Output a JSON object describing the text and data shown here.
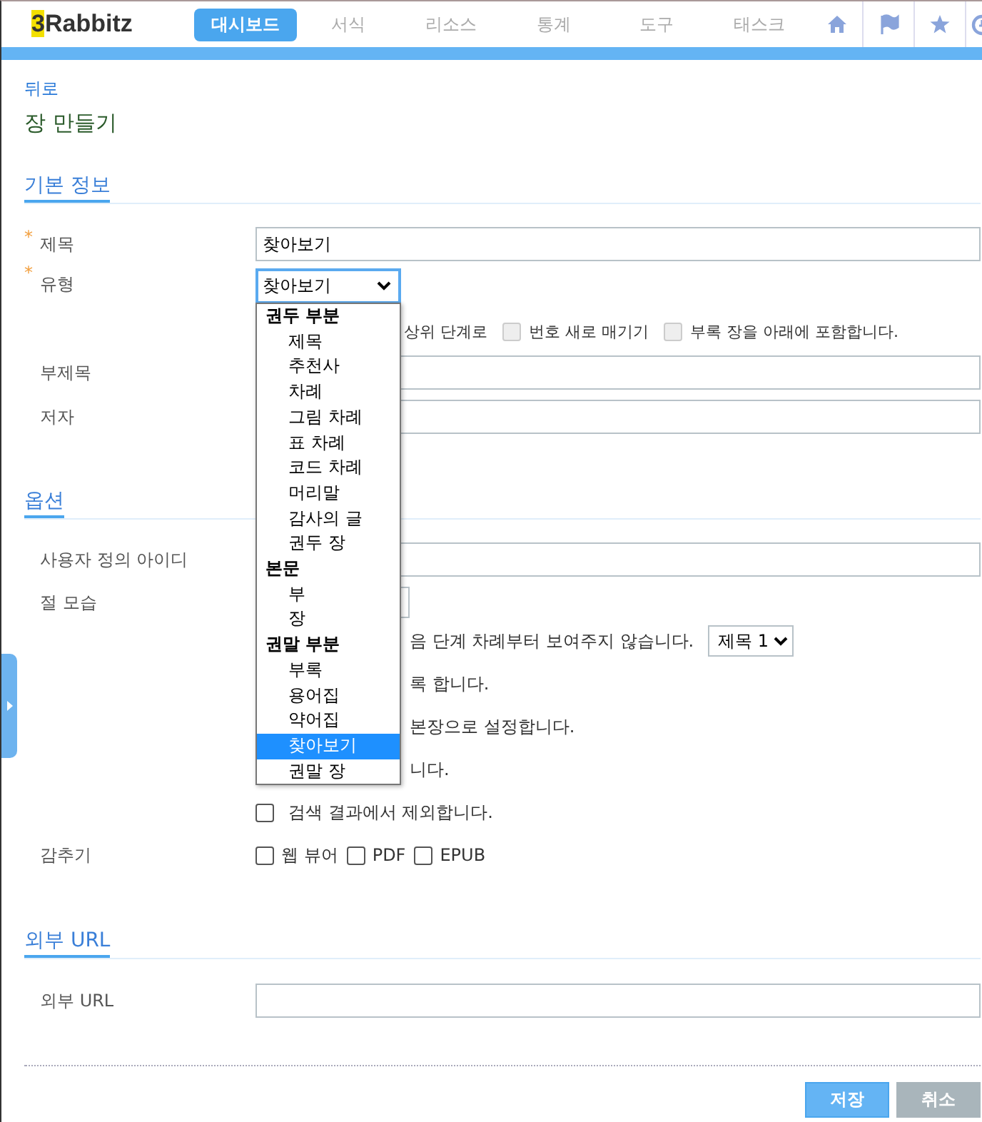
{
  "header": {
    "logo": {
      "digit": "3",
      "letters": "Rabbitz"
    },
    "tabs": [
      {
        "label": "대시보드",
        "selected": true
      },
      {
        "label": "서식",
        "selected": false
      },
      {
        "label": "리소스",
        "selected": false
      },
      {
        "label": "통계",
        "selected": false
      },
      {
        "label": "도구",
        "selected": false
      },
      {
        "label": "태스크",
        "selected": false
      }
    ]
  },
  "back_link": "뒤로",
  "page_title": "장 만들기",
  "basic_info": {
    "heading": "기본 정보",
    "title_field": {
      "label": "제목",
      "required_mark": "*",
      "value": "찾아보기"
    },
    "type_field": {
      "label": "유형",
      "required_mark": "*",
      "value": "찾아보기"
    },
    "type_checks": [
      {
        "kind": "partial",
        "text": "상위 단계로"
      },
      {
        "kind": "checkbox",
        "text": "번호 새로 매기기",
        "checked": false,
        "disabled": true
      },
      {
        "kind": "checkbox",
        "text": "부록 장을 아래에 포함합니다.",
        "checked": false,
        "disabled": true
      }
    ],
    "subtitle_field": {
      "label": "부제목"
    },
    "author_field": {
      "label": "저자"
    }
  },
  "options": {
    "heading": "옵션",
    "custom_id_field": {
      "label": "사용자 정의 아이디"
    },
    "section_style_label": "절 모습",
    "rows": [
      {
        "kind": "text_select",
        "text": "음 단계 차례부터 보여주지 않습니다.",
        "select_value": "제목 1"
      },
      {
        "kind": "partial",
        "text": "록 합니다."
      },
      {
        "kind": "partial",
        "text": "본장으로 설정합니다."
      },
      {
        "kind": "partial",
        "text": "니다."
      },
      {
        "kind": "checkbox",
        "text": "검색 결과에서 제외합니다.",
        "checked": false
      }
    ],
    "hide": {
      "label": "감추기",
      "options": [
        {
          "label": "웹 뷰어",
          "checked": false
        },
        {
          "label": "PDF",
          "checked": false
        },
        {
          "label": "EPUB",
          "checked": false
        }
      ]
    }
  },
  "external": {
    "heading": "외부 URL",
    "field": {
      "label": "외부 URL"
    }
  },
  "buttons": [
    {
      "label": "저장",
      "kind": "primary"
    },
    {
      "label": "취소",
      "kind": "secondary"
    }
  ],
  "type_dropdown": {
    "groups": [
      {
        "label": "권두 부분",
        "options": [
          {
            "label": "제목",
            "selected": false
          },
          {
            "label": "추천사",
            "selected": false
          },
          {
            "label": "차례",
            "selected": false
          },
          {
            "label": "그림 차례",
            "selected": false
          },
          {
            "label": "표 차례",
            "selected": false
          },
          {
            "label": "코드 차례",
            "selected": false
          },
          {
            "label": "머리말",
            "selected": false
          },
          {
            "label": "감사의 글",
            "selected": false
          },
          {
            "label": "권두 장",
            "selected": false
          }
        ]
      },
      {
        "label": "본문",
        "options": [
          {
            "label": "부",
            "selected": false
          },
          {
            "label": "장",
            "selected": false
          }
        ]
      },
      {
        "label": "권말 부분",
        "options": [
          {
            "label": "부록",
            "selected": false
          },
          {
            "label": "용어집",
            "selected": false
          },
          {
            "label": "약어집",
            "selected": false
          },
          {
            "label": "찾아보기",
            "selected": true
          },
          {
            "label": "권말 장",
            "selected": false
          }
        ]
      }
    ]
  }
}
